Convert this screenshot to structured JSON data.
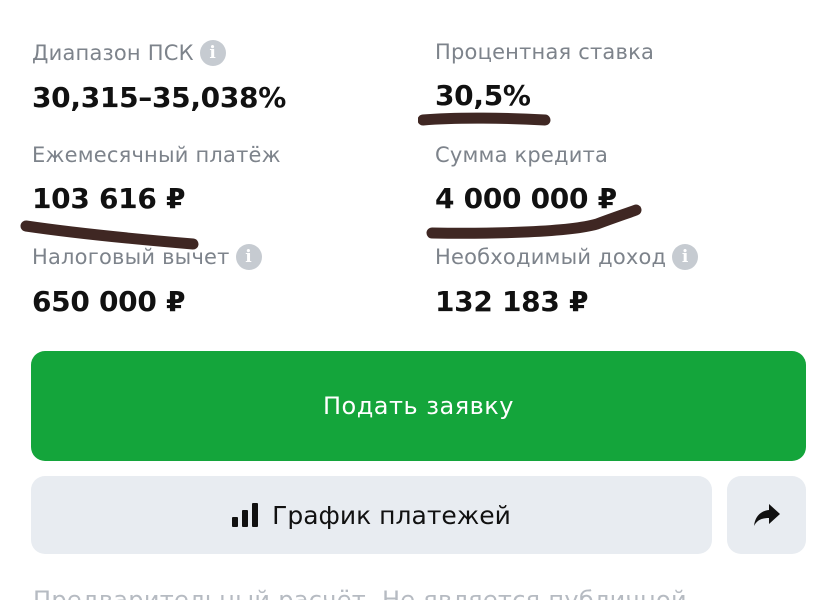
{
  "stats": [
    {
      "label": "Диапазон ПСК",
      "value": "30,315–35,038%",
      "info": true
    },
    {
      "label": "Процентная ставка",
      "value": "30,5%",
      "info": false
    },
    {
      "label": "Ежемесячный платёж",
      "value": "103 616 ₽",
      "info": false
    },
    {
      "label": "Сумма кредита",
      "value": "4 000 000 ₽",
      "info": false
    },
    {
      "label": "Налоговый вычет",
      "value": "650 000 ₽",
      "info": true
    },
    {
      "label": "Необходимый доход",
      "value": "132 183 ₽",
      "info": true
    }
  ],
  "info_glyph": "i",
  "buttons": {
    "apply_label": "Подать заявку",
    "schedule_label": "График платежей",
    "share_icon": "share-arrow-icon"
  },
  "disclaimer": "Предварительный расчёт. Не является публичной",
  "colors": {
    "primary_green": "#14a53b",
    "secondary_bg": "#e8ecf1",
    "label_gray": "#7d838b",
    "scribble": "#3f2723"
  }
}
